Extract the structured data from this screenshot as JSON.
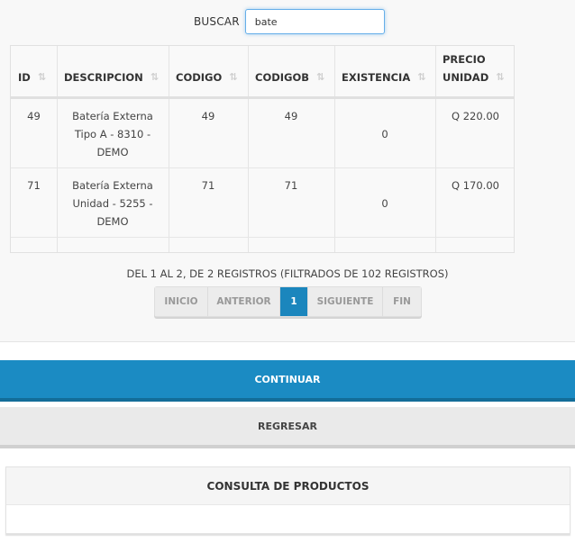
{
  "search": {
    "label": "BUSCAR",
    "value": "bate",
    "placeholder": ""
  },
  "table": {
    "headers": [
      {
        "label": "ID",
        "sort": "⇅"
      },
      {
        "label": "DESCRIPCION",
        "sort": "⇅"
      },
      {
        "label": "CODIGO",
        "sort": "⇅"
      },
      {
        "label": "CODIGOB",
        "sort": "⇅"
      },
      {
        "label": "EXISTENCIA",
        "sort": "⇅"
      },
      {
        "label": "PRECIO",
        "label2": "UNIDAD",
        "sort": "⇅"
      }
    ],
    "rows": [
      {
        "id": "49",
        "desc": [
          "Batería Externa",
          "Tipo A - 8310 -",
          "DEMO"
        ],
        "codigo": "49",
        "codigob": "49",
        "existencia": "0",
        "precio": "Q 220.00"
      },
      {
        "id": "71",
        "desc": [
          "Batería Externa",
          "Unidad - 5255 -",
          "DEMO"
        ],
        "codigo": "71",
        "codigob": "71",
        "existencia": "0",
        "precio": "Q 170.00"
      }
    ]
  },
  "info": "DEL 1 AL 2, DE 2 REGISTROS (FILTRADOS DE 102 REGISTROS)",
  "pagination": {
    "items": [
      "INICIO",
      "ANTERIOR",
      "1",
      "SIGUIENTE",
      "FIN"
    ],
    "active_index": 2
  },
  "buttons": {
    "continue": "CONTINUAR",
    "back": "REGRESAR"
  },
  "panel": {
    "title": "CONSULTA DE PRODUCTOS"
  },
  "colors": {
    "primary": "#1b8bc3",
    "primary_dark": "#136d99",
    "focus": "#66afe9"
  }
}
